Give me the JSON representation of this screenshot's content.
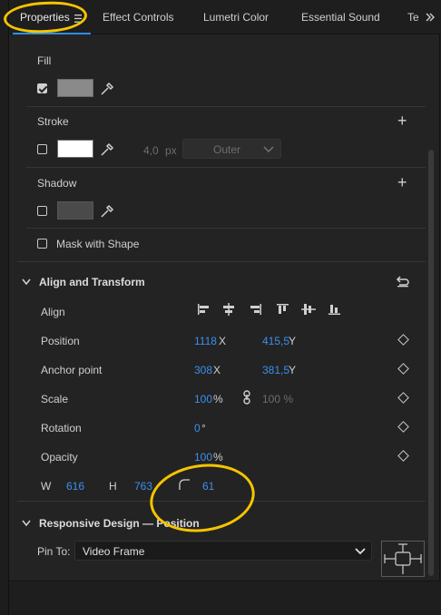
{
  "tabs": {
    "items": [
      "Properties",
      "Effect Controls",
      "Lumetri Color",
      "Essential Sound",
      "Te"
    ],
    "menu_icon": "hamburger-icon",
    "overflow_icon": "double-chevron-right-icon"
  },
  "appearance": {
    "fill_label": "Fill",
    "fill_checked": true,
    "fill_color": "#8a8a8a",
    "stroke_label": "Stroke",
    "stroke_checked": false,
    "stroke_color": "#ffffff",
    "stroke_width": "4,0",
    "stroke_unit": "px",
    "stroke_position": "Outer",
    "shadow_label": "Shadow",
    "shadow_checked": false,
    "shadow_color": "#4a4a4a",
    "mask_label": "Mask with Shape",
    "mask_checked": false
  },
  "align_transform": {
    "title": "Align and Transform",
    "reset_icon": "reset-icon",
    "align_label": "Align",
    "position_label": "Position",
    "position_x": "1118",
    "position_x_unit": "X",
    "position_y": "415,5",
    "position_y_unit": "Y",
    "anchor_label": "Anchor point",
    "anchor_x": "308",
    "anchor_x_unit": "X",
    "anchor_y": "381,5",
    "anchor_y_unit": "Y",
    "scale_label": "Scale",
    "scale_value": "100",
    "scale_unit": "%",
    "scale_linked_value": "100 %",
    "rotation_label": "Rotation",
    "rotation_value": "0",
    "rotation_unit": "°",
    "opacity_label": "Opacity",
    "opacity_value": "100",
    "opacity_unit": "%",
    "w_label": "W",
    "w_value": "616",
    "h_label": "H",
    "h_value": "763",
    "corner_radius": "61"
  },
  "responsive": {
    "title": "Responsive Design — Position",
    "pin_label": "Pin To:",
    "pin_value": "Video Frame"
  },
  "colors": {
    "accent_blue": "#3b8ef0",
    "annotation_yellow": "#f5c400"
  }
}
